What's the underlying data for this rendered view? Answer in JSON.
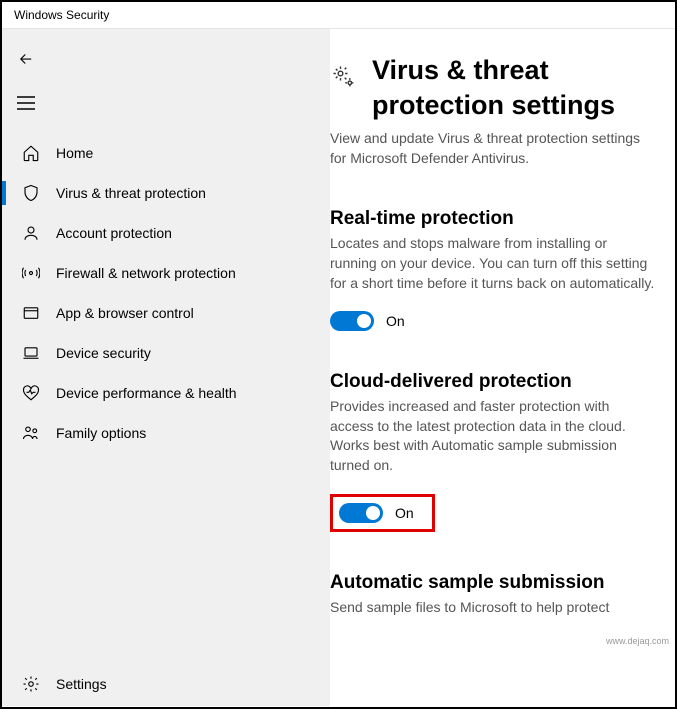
{
  "window": {
    "title": "Windows Security"
  },
  "sidebar": {
    "items": [
      {
        "label": "Home"
      },
      {
        "label": "Virus & threat protection"
      },
      {
        "label": "Account protection"
      },
      {
        "label": "Firewall & network protection"
      },
      {
        "label": "App & browser control"
      },
      {
        "label": "Device security"
      },
      {
        "label": "Device performance & health"
      },
      {
        "label": "Family options"
      }
    ],
    "settings_label": "Settings"
  },
  "page": {
    "title": "Virus & threat protection settings",
    "subtitle": "View and update Virus & threat protection settings for Microsoft Defender Antivirus."
  },
  "sections": {
    "realtime": {
      "heading": "Real-time protection",
      "body": "Locates and stops malware from installing or running on your device. You can turn off this setting for a short time before it turns back on automatically.",
      "toggle_state": "On"
    },
    "cloud": {
      "heading": "Cloud-delivered protection",
      "body": "Provides increased and faster protection with access to the latest protection data in the cloud. Works best with Automatic sample submission turned on.",
      "toggle_state": "On"
    },
    "auto_sample": {
      "heading": "Automatic sample submission",
      "body": "Send sample files to Microsoft to help protect"
    }
  },
  "watermark": "www.dejaq.com"
}
